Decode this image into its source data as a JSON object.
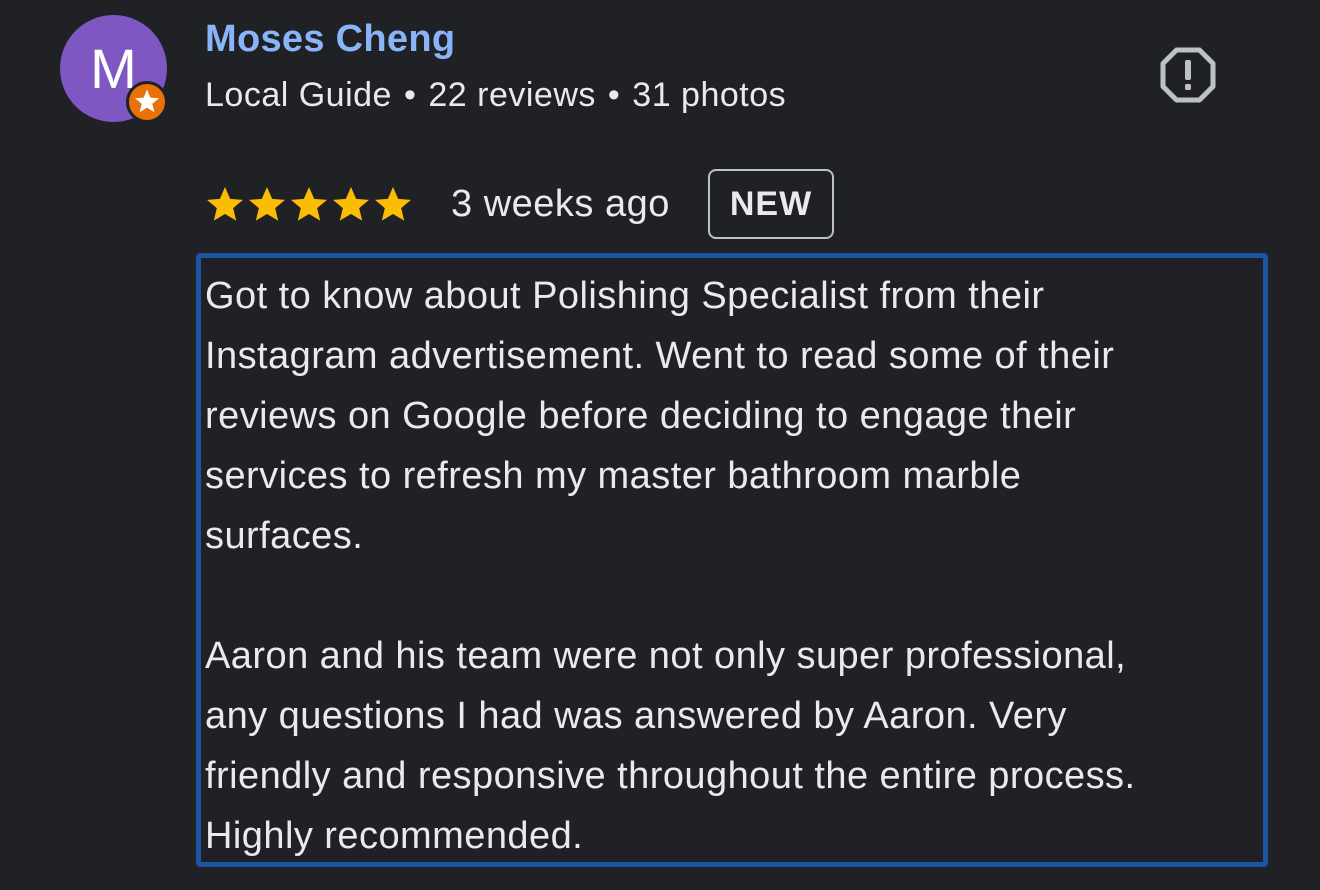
{
  "reviewer": {
    "avatar_letter": "M",
    "avatar_color": "#7e57c2",
    "name": "Moses Cheng",
    "level": "Local Guide",
    "separator": "•",
    "reviews": "22 reviews",
    "photos": "31 photos",
    "badge_icon": "local-guide-star-icon"
  },
  "review": {
    "rating": 5,
    "max_rating": 5,
    "date": "3 weeks ago",
    "new_badge": "NEW",
    "text": "Got to know about Polishing Specialist from their\nInstagram advertisement. Went to read some of their\nreviews on Google before deciding to engage their\nservices to refresh my master bathroom marble\nsurfaces.\n\nAaron and his team were not only super professional,\nany questions I had was answered by Aaron. Very\nfriendly and responsive throughout the entire process.\nHighly recommended."
  },
  "actions": {
    "report_icon": "report-icon"
  },
  "colors": {
    "background": "#202124",
    "name": "#8ab4f8",
    "star": "#fbbc04",
    "badge": "#e8710a",
    "highlight_border": "#1a56a4",
    "text": "#e8eaed"
  }
}
